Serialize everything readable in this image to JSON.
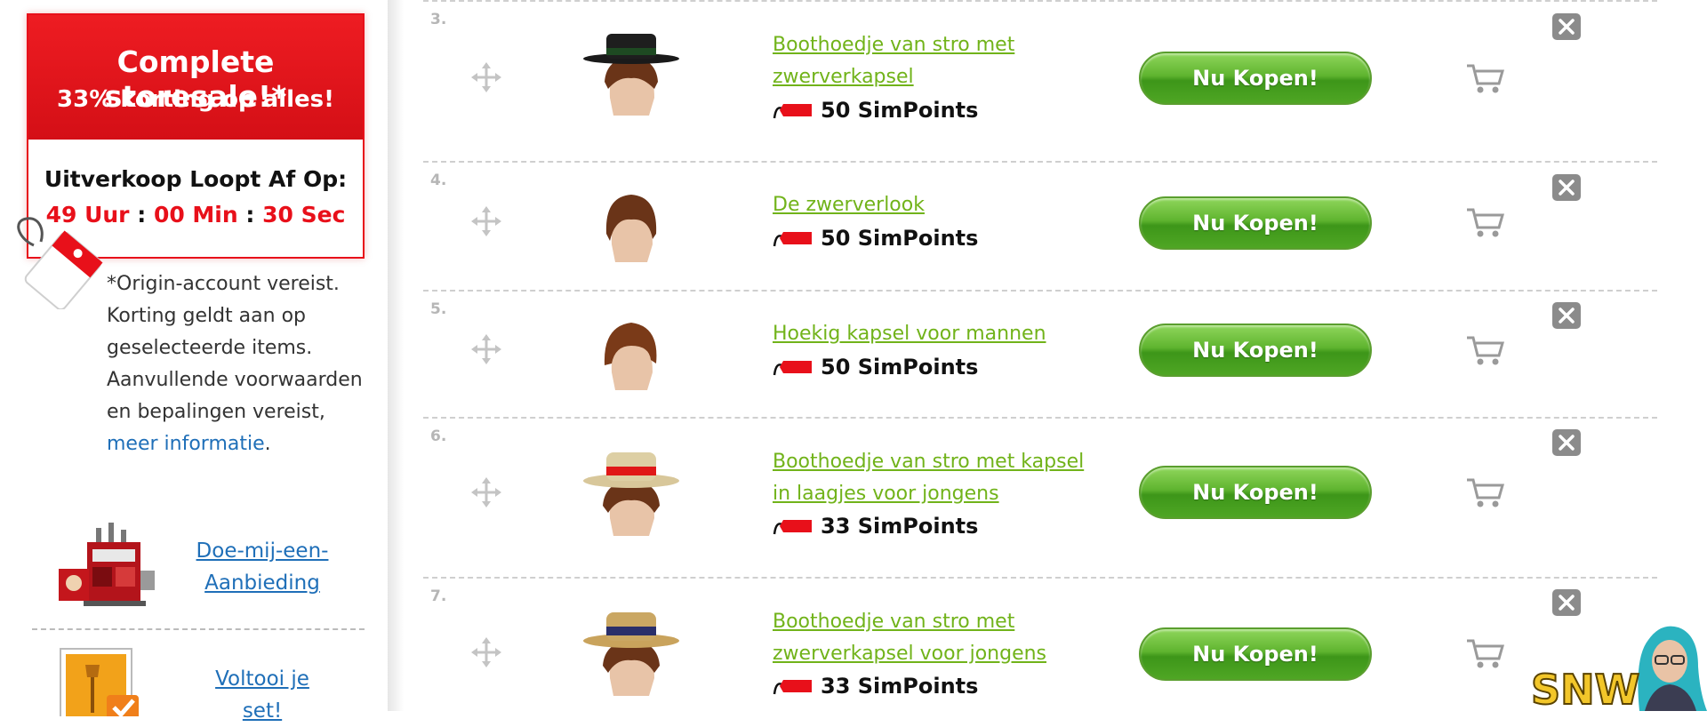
{
  "sidebar": {
    "sale": {
      "title": "Complete storesale!*",
      "subtitle": "33% korting op alles!",
      "expiry_label": "Uitverkoop Loopt Af Op:",
      "hours": "49 Uur",
      "minutes": "00 Min",
      "seconds": "30 Sec",
      "sep": ":"
    },
    "disclaimer": {
      "line1": "*Origin-account vereist.",
      "line2": "Korting geldt aan op",
      "line3": "geselecteerde items.",
      "line4": "Aanvullende voorwaarden",
      "line5": "en bepalingen vereist,",
      "link": "meer informatie",
      "end": "."
    },
    "offer": {
      "line1": "Doe-mij-een-",
      "line2": "Aanbieding"
    },
    "complete_set": {
      "line1": "Voltooi je",
      "line2": "set!"
    }
  },
  "items": [
    {
      "num": "3.",
      "name_line1": "Boothoedje van stro met",
      "name_line2": "zwerverkapsel",
      "price": "50 SimPoints",
      "button": "Nu Kopen!"
    },
    {
      "num": "4.",
      "name_line1": "De zwerverlook",
      "name_line2": "",
      "price": "50 SimPoints",
      "button": "Nu Kopen!"
    },
    {
      "num": "5.",
      "name_line1": "Hoekig kapsel voor mannen",
      "name_line2": "",
      "price": "50 SimPoints",
      "button": "Nu Kopen!"
    },
    {
      "num": "6.",
      "name_line1": "Boothoedje van stro met kapsel",
      "name_line2": "in laagjes voor jongens",
      "price": "33 SimPoints",
      "button": "Nu Kopen!"
    },
    {
      "num": "7.",
      "name_line1": "Boothoedje van stro met",
      "name_line2": "zwerverkapsel voor jongens",
      "price": "33 SimPoints",
      "button": "Nu Kopen!"
    }
  ],
  "watermark": {
    "text": "SNW"
  },
  "colors": {
    "sale_red": "#e8101a",
    "link_green": "#71b31a",
    "link_blue": "#1f6fb8",
    "button_green": "#4fa624",
    "close_gray": "#8b8b8b"
  }
}
